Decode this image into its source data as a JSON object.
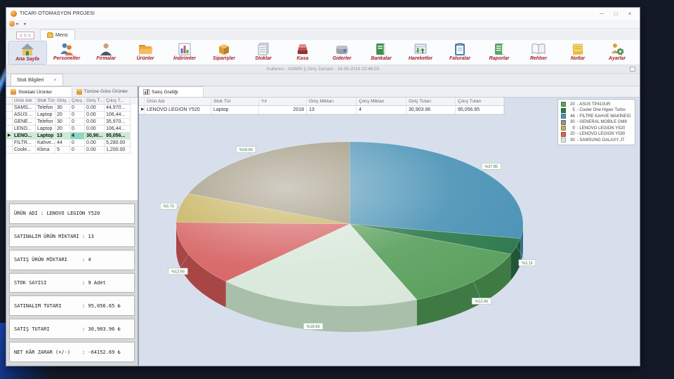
{
  "window": {
    "title": "TICARI OTOMASYON PROJESI",
    "minimize": "─",
    "maximize": "□",
    "close": "×"
  },
  "menu_bar": {
    "tab_label": "Menü"
  },
  "ribbon": {
    "items": [
      {
        "label": "Ana Sayfa",
        "icon": "home-icon",
        "active": true
      },
      {
        "label": "Personeller",
        "icon": "people-icon",
        "active": false
      },
      {
        "label": "Firmalar",
        "icon": "person-icon",
        "active": false
      },
      {
        "label": "Ürünler",
        "icon": "folder-icon",
        "active": false
      },
      {
        "label": "İndirimler",
        "icon": "chart-icon",
        "active": false
      },
      {
        "label": "Siparişler",
        "icon": "box-icon",
        "active": false
      },
      {
        "label": "Stoklar",
        "icon": "papers-icon",
        "active": false
      },
      {
        "label": "Kasa",
        "icon": "cash-icon",
        "active": false
      },
      {
        "label": "Giderler",
        "icon": "wallet-icon",
        "active": false
      },
      {
        "label": "Bankalar",
        "icon": "bank-icon",
        "active": false
      },
      {
        "label": "Hareketler",
        "icon": "transfer-icon",
        "active": false
      },
      {
        "label": "Faturalar",
        "icon": "invoice-icon",
        "active": false
      },
      {
        "label": "Raporlar",
        "icon": "report-icon",
        "active": false
      },
      {
        "label": "Rehber",
        "icon": "book-icon",
        "active": false
      },
      {
        "label": "Notlar",
        "icon": "notes-icon",
        "active": false
      },
      {
        "label": "Ayarlar",
        "icon": "settings-icon",
        "active": false
      }
    ]
  },
  "status_strip": {
    "text": "Kullanıcı : ADMIN    ||    Giriş Zamanı : 24.06.2018 23:46:03"
  },
  "doc_tab": {
    "label": "Stok Bilgileri",
    "close": "×"
  },
  "left_pane": {
    "tabs": [
      {
        "label": "Stoktaki Ürünler",
        "active": true
      },
      {
        "label": "Türüne Göre Ürünler",
        "active": false
      }
    ],
    "table": {
      "columns": [
        "Ürün Adı",
        "Stok Tür",
        "Giriş ...",
        "Çıkış ...",
        "Giriş T...",
        "Çıkış T..."
      ],
      "rows": [
        {
          "cells": [
            "SAMS...",
            "Telefon",
            "30",
            "0",
            "0.00",
            "44,970..."
          ],
          "selected": false
        },
        {
          "cells": [
            "ASUS ...",
            "Laptop",
            "20",
            "0",
            "0.00",
            "106,44..."
          ],
          "selected": false
        },
        {
          "cells": [
            "GENE...",
            "Telefon",
            "30",
            "0",
            "0.00",
            "35,970..."
          ],
          "selected": false
        },
        {
          "cells": [
            "LENO...",
            "Laptop",
            "20",
            "0",
            "0.00",
            "106,44..."
          ],
          "selected": false
        },
        {
          "cells": [
            "LENO...",
            "Laptop",
            "13",
            "4",
            "30,90...",
            "95,056..."
          ],
          "selected": true
        },
        {
          "cells": [
            "FİLTR...",
            "Kahve...",
            "44",
            "0",
            "0.00",
            "5,280.00"
          ],
          "selected": false
        },
        {
          "cells": [
            "Coole...",
            "Klima",
            "5",
            "0",
            "0.00",
            "1,200.00"
          ],
          "selected": false
        }
      ]
    },
    "summary": [
      "ÜRÜN ADI : LENOVO LEGION Y520",
      "SATINALIM ÜRÜN MİKTARI : 13",
      "SATIŞ ÜRÜN MİKTARI     : 4",
      "STOK SAYISI            : 9 Adet",
      "SATINALIM TUTARI       : 95,056.65 ₺",
      "SATIŞ TUTARI           : 30,903.96 ₺",
      "NET KÂR ZARAR (+/-)    : -64152.69 ₺"
    ]
  },
  "right_pane": {
    "tab": {
      "label": "Satış Grafiği"
    },
    "table": {
      "columns": [
        "Ürün Adı",
        "Stok Tür",
        "Yıl",
        "Giriş Miktarı",
        "Çıkış Miktarı",
        "Giriş Tutarı",
        "Çıkış Tutarı"
      ],
      "rows": [
        {
          "cells": [
            "LENOVO LEGION Y520",
            "Laptop",
            "2018",
            "13",
            "4",
            "30,903.96",
            "95,056.65"
          ],
          "selected": true
        }
      ]
    }
  },
  "chart_data": {
    "type": "pie",
    "style": "3d",
    "legend_position": "top-right",
    "items": [
      {
        "name": "ASUS TP410UR",
        "count": 20,
        "percent": 12.66,
        "color": "#5ca15f",
        "side_color": "#3f7a45"
      },
      {
        "name": "Cooler One Hyper Turbo",
        "count": 5,
        "percent": 3.16,
        "color": "#2f7a4e",
        "side_color": "#1f5636"
      },
      {
        "name": "FİLTRE KAHVE MAKİNESİ",
        "count": 44,
        "percent": 27.85,
        "color": "#4b93b6",
        "side_color": "#356f8c"
      },
      {
        "name": "GENERAL MOBILE GM8",
        "count": 30,
        "percent": 18.99,
        "color": "#9a9179",
        "side_color": "#746c58"
      },
      {
        "name": "LENOVO LEGION Y520",
        "count": 9,
        "percent": 5.7,
        "color": "#c3ad53",
        "side_color": "#96833a"
      },
      {
        "name": "LENOVO LEGION Y530",
        "count": 20,
        "percent": 12.66,
        "color": "#d66161",
        "side_color": "#a84646"
      },
      {
        "name": "SAMSUNG GALAXY J7",
        "count": 30,
        "percent": 18.99,
        "color": "#d9e8da",
        "side_color": "#a9bfaa"
      }
    ],
    "draw_order": [
      2,
      1,
      0,
      6,
      5,
      4,
      3
    ],
    "start_angle_deg": 0,
    "label_format": "%{percent}"
  }
}
